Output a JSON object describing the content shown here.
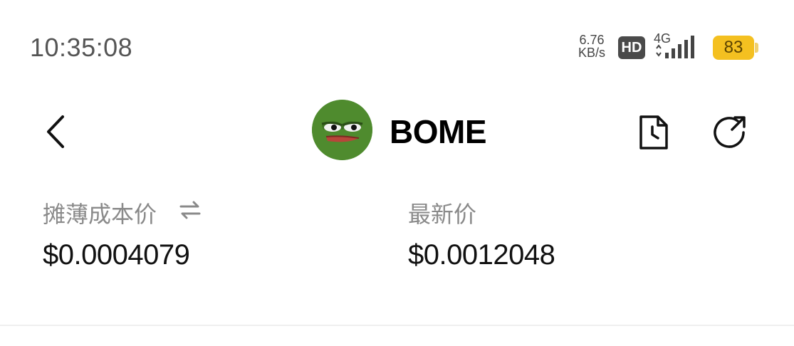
{
  "status_bar": {
    "time": "10:35:08",
    "net_speed_value": "6.76",
    "net_speed_unit": "KB/s",
    "hd_label": "HD",
    "network_type": "4G",
    "battery_level": "83",
    "battery_color": "#f4c020"
  },
  "header": {
    "coin_name": "BOME",
    "logo_icon": "pepe-frog-icon",
    "back_icon": "chevron-left-icon",
    "history_icon": "document-clock-icon",
    "share_icon": "share-arrow-icon"
  },
  "prices": {
    "cost_label": "摊薄成本价",
    "cost_toggle_icon": "swap-arrows-icon",
    "cost_value": "$0.0004079",
    "latest_label": "最新价",
    "latest_value": "$0.0012048"
  }
}
